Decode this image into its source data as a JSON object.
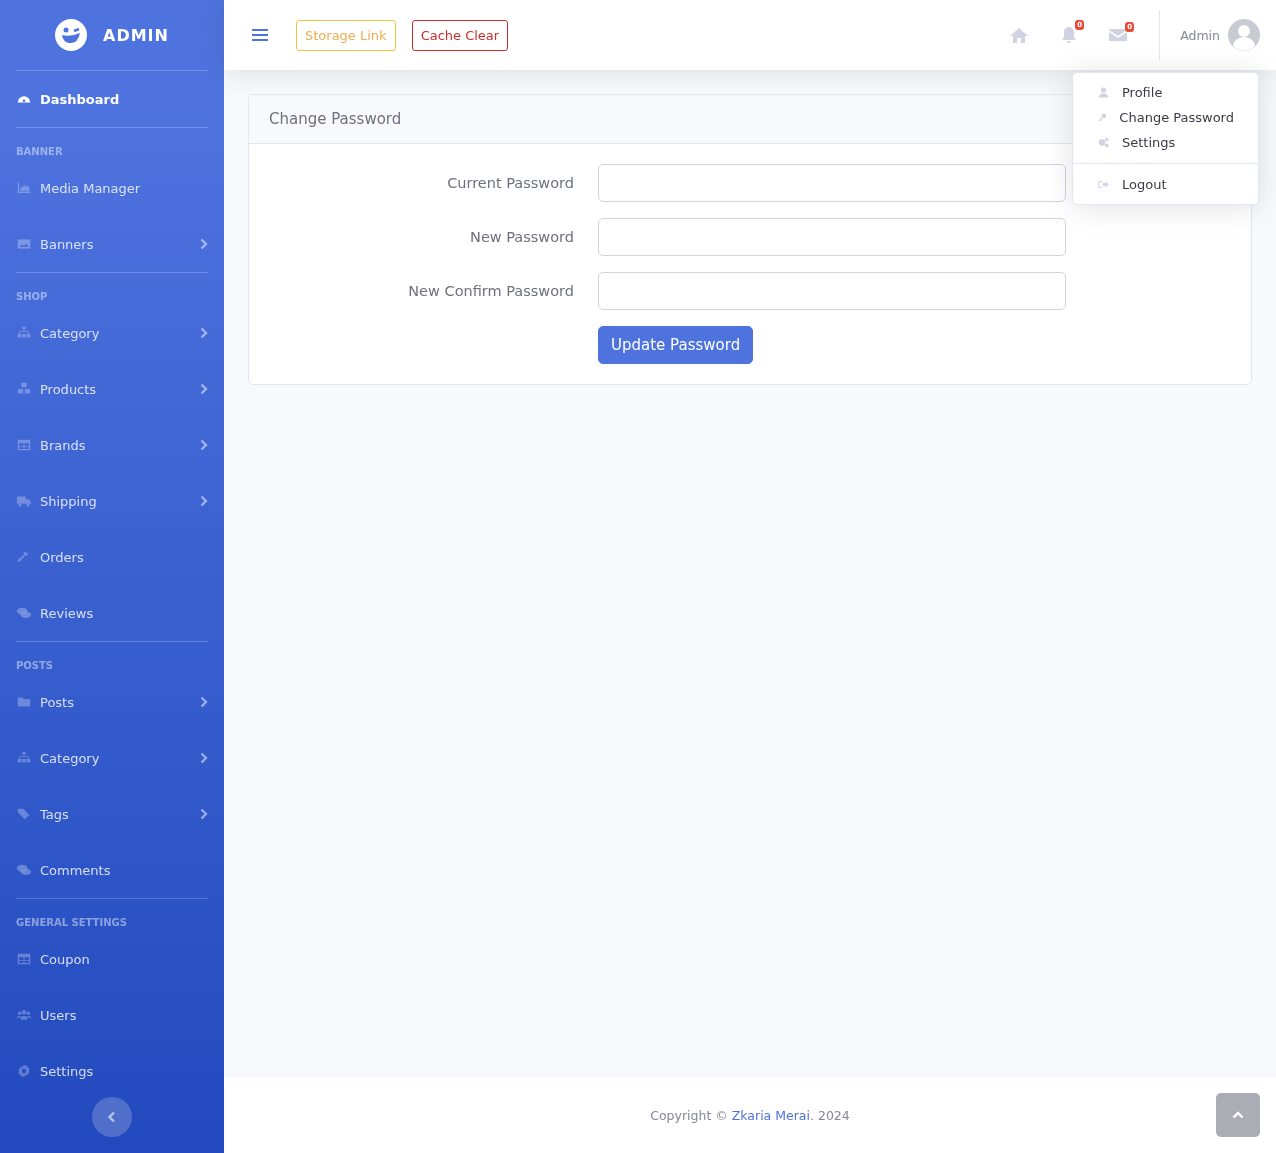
{
  "sidebar": {
    "brand": "ADMIN",
    "sections": [
      {
        "items": [
          {
            "label": "Dashboard",
            "selected": true,
            "has_submenu": false
          }
        ]
      },
      {
        "heading": "BANNER",
        "items": [
          {
            "label": "Media Manager",
            "selected": false,
            "has_submenu": false
          },
          {
            "label": "Banners",
            "selected": false,
            "has_submenu": true
          }
        ]
      },
      {
        "heading": "SHOP",
        "items": [
          {
            "label": "Category",
            "selected": false,
            "has_submenu": true
          },
          {
            "label": "Products",
            "selected": false,
            "has_submenu": true
          },
          {
            "label": "Brands",
            "selected": false,
            "has_submenu": true
          },
          {
            "label": "Shipping",
            "selected": false,
            "has_submenu": true
          },
          {
            "label": "Orders",
            "selected": false,
            "has_submenu": false
          },
          {
            "label": "Reviews",
            "selected": false,
            "has_submenu": false
          }
        ]
      },
      {
        "heading": "POSTS",
        "items": [
          {
            "label": "Posts",
            "selected": false,
            "has_submenu": true
          },
          {
            "label": "Category",
            "selected": false,
            "has_submenu": true
          },
          {
            "label": "Tags",
            "selected": false,
            "has_submenu": true
          },
          {
            "label": "Comments",
            "selected": false,
            "has_submenu": false
          }
        ]
      },
      {
        "heading": "GENERAL SETTINGS",
        "items": [
          {
            "label": "Coupon",
            "selected": false,
            "has_submenu": false
          },
          {
            "label": "Users",
            "selected": false,
            "has_submenu": false
          },
          {
            "label": "Settings",
            "selected": false,
            "has_submenu": false
          }
        ]
      }
    ]
  },
  "topbar": {
    "buttons": [
      {
        "label": "Storage Link",
        "kind": "warning"
      },
      {
        "label": "Cache Clear",
        "kind": "danger"
      }
    ],
    "alerts_badge": "0",
    "messages_badge": "0",
    "user_name": "Admin"
  },
  "user_menu": {
    "open": true,
    "items": [
      {
        "label": "Profile",
        "kind": "item"
      },
      {
        "label": "Change Password",
        "kind": "item"
      },
      {
        "label": "Settings",
        "kind": "item"
      },
      {
        "label": "Logout",
        "kind": "logout"
      }
    ]
  },
  "card": {
    "title": "Change Password",
    "fields": [
      {
        "label": "Current Password"
      },
      {
        "label": "New Password"
      },
      {
        "label": "New Confirm Password"
      }
    ],
    "submit": "Update Password"
  },
  "footer": {
    "prefix": "Copyright © ",
    "author": "Zkaria Merai",
    "suffix": ". 2024"
  }
}
